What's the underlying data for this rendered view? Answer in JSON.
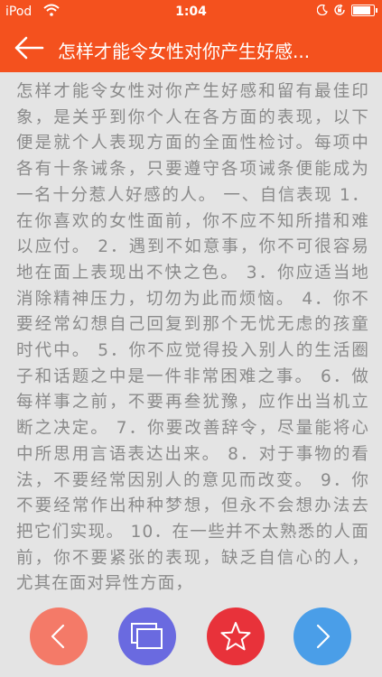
{
  "status_bar": {
    "carrier": "iPod",
    "time": "1:04"
  },
  "nav": {
    "title": "怎样才能令女性对你产生好感..."
  },
  "article": {
    "text": "怎样才能令女性对你产生好感和留有最佳印象，是关乎到你个人在各方面的表现，以下便是就个人表现方面的全面性检讨。每项中各有十条诫条，只要遵守各项诫条便能成为一名十分惹人好感的人。 一、自信表现 1．在你喜欢的女性面前，你不应不知所措和难以应付。 2．遇到不如意事，你不可很容易地在面上表现出不快之色。 3．你应适当地消除精神压力，切勿为此而烦恼。 4．你不要经常幻想自己回复到那个无忧无虑的孩童时代中。 5．你不应觉得投入别人的生活圈子和话题之中是一件非常困难之事。 6．做每样事之前，不要再叁犹豫，应作出当机立断之决定。 7．你要改善辞令，尽量能将心中所思用言语表达出来。 8．对于事物的看法，不要经常因别人的意见而改变。 9．你不要经常作出种种梦想，但永不会想办法去把它们实现。 10．在一些并不太熟悉的人面前，你不要紧张的表现，缺乏自信心的人，尤其在面对异性方面，"
  },
  "buttons": {
    "prev_icon": "chevron-left-icon",
    "catalog_icon": "stacked-pages-icon",
    "favorite_icon": "star-icon",
    "next_icon": "chevron-right-icon"
  },
  "colors": {
    "brand": "#f4511e",
    "prev": "#f47a68",
    "catalog": "#6a6ae0",
    "favorite": "#e8323a",
    "next": "#4a9ee8"
  }
}
